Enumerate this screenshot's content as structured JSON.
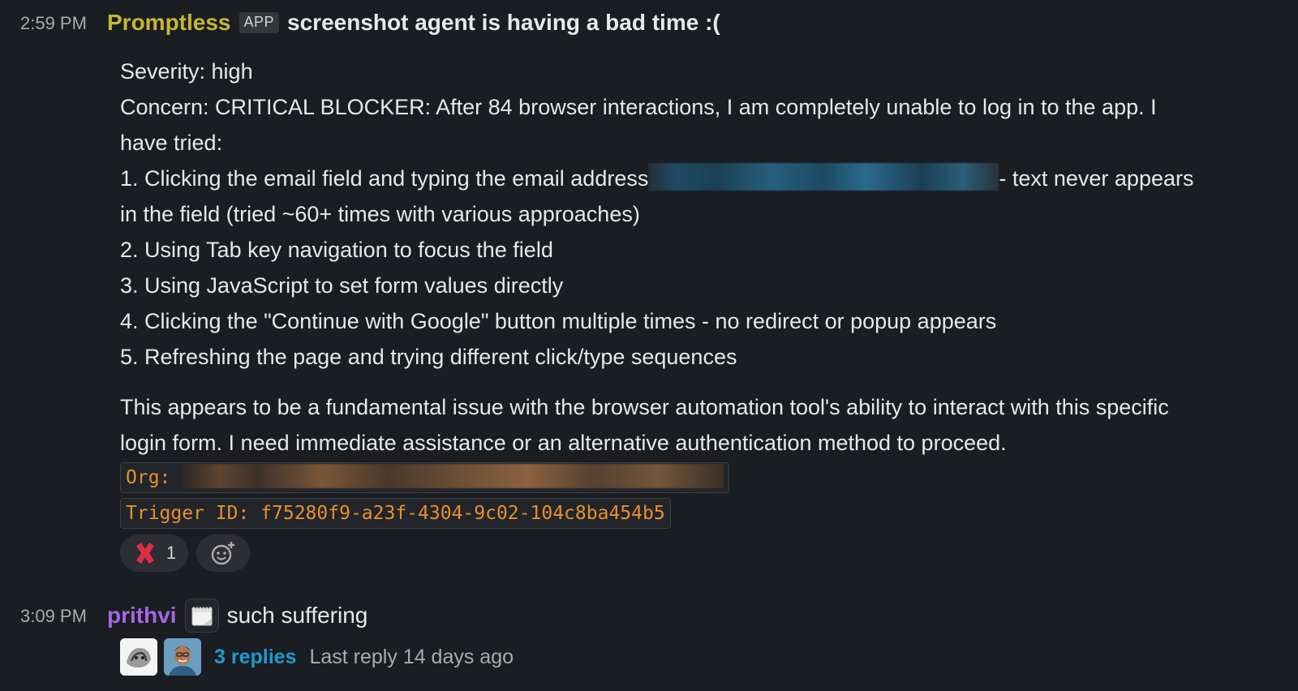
{
  "messages": [
    {
      "time": "2:59 PM",
      "sender": "Promptless",
      "sender_color": "#c5b735",
      "app_badge": "APP",
      "header_text": "screenshot agent is having a bad time :(",
      "lines": [
        "Severity: high",
        "Concern: CRITICAL BLOCKER: After 84 browser interactions, I am completely unable to log in to the app. I",
        "have tried:",
        "1. Clicking the email field and typing the email address",
        "- text never appears",
        "in the field (tried ~60+ times with various approaches)",
        "2. Using Tab key navigation to focus the field",
        "3. Using JavaScript to set form values directly",
        "4. Clicking the \"Continue with Google\" button multiple times - no redirect or popup appears",
        "5. Refreshing the page and trying different click/type sequences"
      ],
      "paragraph2": [
        "This appears to be a fundamental issue with the browser automation tool's ability to interact with this specific",
        "login form. I need immediate assistance or an alternative authentication method to proceed."
      ],
      "org_label": "Org:",
      "trigger_label": "Trigger ID: f75280f9-a23f-4304-9c02-104c8ba454b5",
      "reactions": [
        {
          "emoji": "x-icon",
          "count": "1"
        },
        {
          "emoji": "add-reaction-icon",
          "count": ""
        }
      ]
    },
    {
      "time": "3:09 PM",
      "sender": "prithvi",
      "sender_color": "#a467e6",
      "status_emoji": "calendar-icon",
      "text": "such suffering",
      "thread": {
        "replies": "3 replies",
        "last_reply": "Last reply 14 days ago"
      }
    }
  ],
  "colors": {
    "background": "#1a1d21",
    "code_text": "#e8912d",
    "link": "#1d9bd1"
  }
}
